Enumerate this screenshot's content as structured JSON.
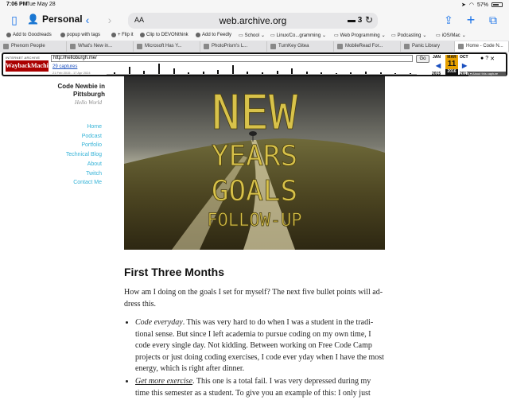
{
  "status": {
    "time": "7:06 PM",
    "date": "Tue May 28",
    "battery": "57%"
  },
  "toolbar": {
    "profile": "Personal",
    "aa": "AA",
    "url": "web.archive.org",
    "ext_count": "3"
  },
  "bookmarks": [
    "Add to Goodreads",
    "popup with tags",
    "+ Flip it",
    "Clip to DEVONthink",
    "Add to Feedly",
    "School",
    "Linux/Co...gramming",
    "Web Programming",
    "Podcasting",
    "iOS/Mac"
  ],
  "tabs": [
    "Phenom People",
    "What's New in...",
    "Microsoft Has Y...",
    "PhotoPrism's L...",
    "TurnKey Gitea",
    "MobileRead For...",
    "Panic Library",
    "Home - Code N..."
  ],
  "wayback": {
    "url": "http://helloburgh.me/",
    "go": "Go",
    "captures": "29 captures",
    "range": "21 Feb 2015 - 17 Apr 2024",
    "prev_month": "JAN",
    "cur_month": "MAR",
    "cur_day": "11",
    "cur_year": "2016",
    "next_month": "OCT",
    "prev_year": "2015",
    "next_year": "2017",
    "about": "About this capture",
    "bars": [
      2,
      8,
      4,
      12,
      6,
      2,
      3,
      5,
      10,
      3,
      2,
      4,
      6,
      3,
      2,
      1,
      2,
      3,
      2,
      1,
      1
    ]
  },
  "site": {
    "title": "Code Newbie in Pittsburgh",
    "subtitle": "Hello World",
    "nav": [
      "Home",
      "Podcast",
      "Portfolio",
      "Technical Blog",
      "About",
      "Twitch",
      "Contact Me"
    ]
  },
  "hero": {
    "line1": "NEW",
    "line2": "YEARS",
    "line3": "GOALS",
    "line4": "FOLLOW-UP"
  },
  "article": {
    "heading": "First Three Months",
    "intro": "How am I doing on the goals I set for myself? The next five bullet points will ad-dress this.",
    "bullets": [
      {
        "lead": "Code everyday",
        "text": ". This was very hard to do when I was a student in the tradi-tional sense. But since I left academia to pursue coding on my own time, I code every single day. Not kidding. Between working on Free Code Camp projects or just doing coding exercises, I code ever yday when I have the most energy, which is right after dinner."
      },
      {
        "lead": "Get more exercise",
        "text": ". This one is a total fail. I was very depressed during my time this semester as a student. To give you an example of this: I only just"
      }
    ]
  }
}
